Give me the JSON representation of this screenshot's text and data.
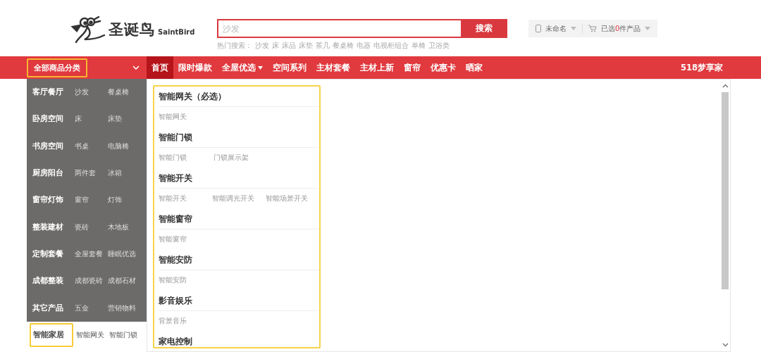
{
  "header": {
    "logo": {
      "name_cn": "圣诞鸟",
      "name_en": "SaintBird"
    },
    "search": {
      "placeholder": "沙发",
      "button": "搜索",
      "hot_label": "热门搜索：",
      "hot_terms": [
        "沙发",
        "床",
        "床品",
        "床垫",
        "茶几",
        "餐桌椅",
        "电器",
        "电视柜组合",
        "单椅",
        "卫浴类"
      ]
    },
    "user": {
      "name": "未命名",
      "cart_prefix": "已选",
      "cart_count": "0",
      "cart_suffix": "件产品"
    }
  },
  "nav": {
    "category_button": "全部商品分类",
    "items": [
      {
        "label": "首页",
        "selected": true,
        "dropdown": false
      },
      {
        "label": "限时爆款",
        "selected": false,
        "dropdown": false
      },
      {
        "label": "全屋优选",
        "selected": false,
        "dropdown": true
      },
      {
        "label": "空间系列",
        "selected": false,
        "dropdown": false
      },
      {
        "label": "主材套餐",
        "selected": false,
        "dropdown": false
      },
      {
        "label": "主材上新",
        "selected": false,
        "dropdown": false
      },
      {
        "label": "窗帘",
        "selected": false,
        "dropdown": false
      },
      {
        "label": "优惠卡",
        "selected": false,
        "dropdown": false
      },
      {
        "label": "晒家",
        "selected": false,
        "dropdown": false
      }
    ],
    "right_link": "518梦享家"
  },
  "categories": [
    {
      "title": "客厅餐厅",
      "items": [
        "沙发",
        "餐桌椅"
      ],
      "selected": false
    },
    {
      "title": "卧房空间",
      "items": [
        "床",
        "床垫"
      ],
      "selected": false
    },
    {
      "title": "书房空间",
      "items": [
        "书桌",
        "电脑椅"
      ],
      "selected": false
    },
    {
      "title": "厨房阳台",
      "items": [
        "两件套",
        "冰箱"
      ],
      "selected": false
    },
    {
      "title": "窗帘灯饰",
      "items": [
        "窗帘",
        "灯饰"
      ],
      "selected": false
    },
    {
      "title": "整装建材",
      "items": [
        "瓷砖",
        "木地板"
      ],
      "selected": false
    },
    {
      "title": "定制套餐",
      "items": [
        "全屋套餐",
        "睡眠优选"
      ],
      "selected": false
    },
    {
      "title": "成都整装",
      "items": [
        "成都瓷砖",
        "成都石材"
      ],
      "selected": false
    },
    {
      "title": "其它产品",
      "items": [
        "五金",
        "营销物料"
      ],
      "selected": false
    },
    {
      "title": "智能家居",
      "items": [
        "智能网关",
        "智能门锁"
      ],
      "selected": true
    }
  ],
  "panel": {
    "sections": [
      {
        "heading": "智能网关（必选）",
        "items": [
          "智能网关"
        ]
      },
      {
        "heading": "智能门锁",
        "items": [
          "智能门锁",
          "门锁展示架"
        ]
      },
      {
        "heading": "智能开关",
        "items": [
          "智能开关",
          "智能调光开关",
          "智能场景开关"
        ]
      },
      {
        "heading": "智能窗帘",
        "items": [
          "智能窗帘"
        ]
      },
      {
        "heading": "智能安防",
        "items": [
          "智能安防"
        ]
      },
      {
        "heading": "影音娱乐",
        "items": [
          "背景音乐"
        ]
      },
      {
        "heading": "家电控制"
      }
    ]
  }
}
